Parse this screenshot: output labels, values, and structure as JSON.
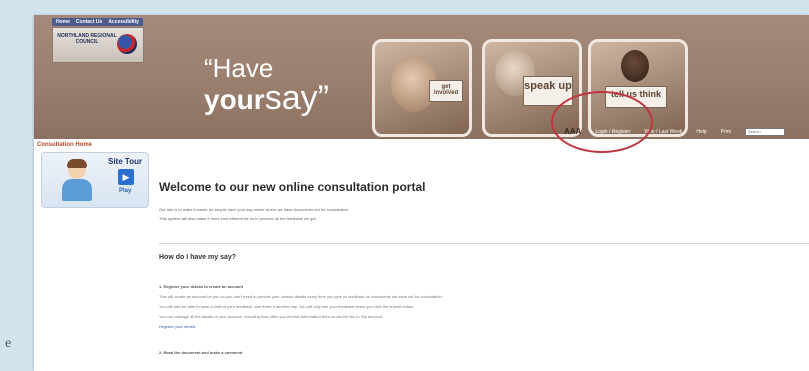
{
  "side_letter": "e",
  "header": {
    "util_links": [
      "Home",
      "Contact Us",
      "Accessibility"
    ],
    "logo_text": "NORTHLAND REGIONAL COUNCIL",
    "tagline": {
      "have": "“Have",
      "your": "your",
      "say": "say”"
    },
    "photo_signs": [
      "get involved",
      "speak up",
      "tell us think"
    ]
  },
  "nav": {
    "text_size": "AAA",
    "login": "Login / Register",
    "whats_new": "Who / Last Week",
    "help": "Help",
    "print": "Print",
    "search_placeholder": "Search"
  },
  "sidebar": {
    "breadcrumb": "Consultation Home",
    "site_tour": {
      "title": "Site Tour",
      "play": "Play"
    }
  },
  "main": {
    "heading": "Welcome to our new online consultation portal",
    "intro": [
      "Our aim is to make it easier for people have your say online where we have documents out for consultation.",
      "This system will also make it more cost efficient for us to process all the feedback we get."
    ],
    "how_heading": "How do I have my say?",
    "step1_title": "1. Register your details to create an account",
    "step1_lines": [
      "This will create an account for you so you don't need to provide your contact details every time you give us feedback on documents we have out for consultation.",
      "You will also be able to save a draft of your feedback, and finish it another day. You will only see your feedback when you click the submit button.",
      "You can manage all the details of your account, including how often you receive information from us via the link to 'My account'."
    ],
    "step1_link": "Register your details",
    "step2_title": "2. Read the document and make a comment"
  },
  "colors": {
    "header_bg": "#9a7e6e",
    "annotation_circle": "#c0363f",
    "breadcrumb": "#b7472a"
  }
}
